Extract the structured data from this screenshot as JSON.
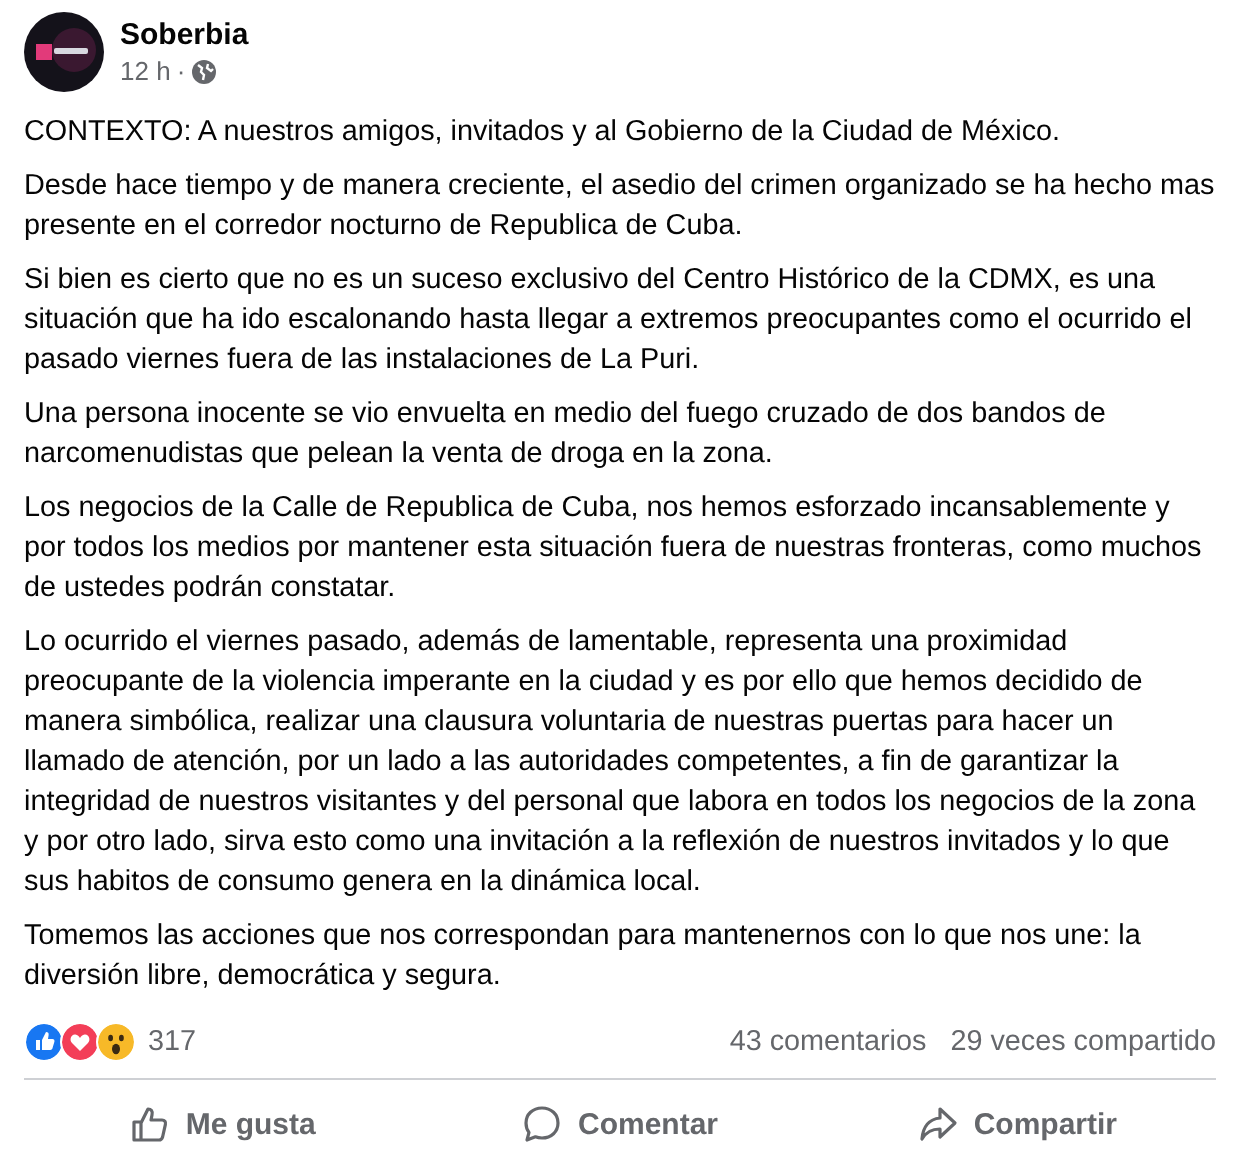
{
  "post": {
    "author": "Soberbia",
    "time": "12 h",
    "separator": "·",
    "paragraphs": [
      "CONTEXTO: A nuestros amigos, invitados y al Gobierno de la Ciudad de México.",
      "Desde hace tiempo y de manera creciente, el asedio del crimen organizado se ha hecho mas presente en el corredor nocturno de Republica de Cuba.",
      "Si bien es cierto que no es un suceso exclusivo del Centro Histórico de la CDMX, es una situación que ha ido escalonando hasta llegar a extremos preocupantes como el ocurrido el pasado viernes fuera de las instalaciones de La Puri.",
      "Una persona inocente se vio envuelta en medio del fuego cruzado de dos bandos de narcomenudistas que pelean la venta de droga en la zona.",
      "Los negocios de la Calle de Republica de Cuba, nos hemos esforzado incansablemente y por todos los medios por mantener esta situación fuera de nuestras fronteras, como muchos de ustedes podrán constatar.",
      "Lo ocurrido el viernes pasado, además de lamentable, representa una proximidad preocupante de la violencia imperante en la ciudad y es por ello que hemos decidido de manera simbólica, realizar una clausura voluntaria de nuestras puertas para hacer un llamado de atención, por un lado a las autoridades competentes, a fin de garantizar la integridad de nuestros visitantes y del personal que labora en todos los negocios de la zona y por otro lado, sirva esto como una invitación a la reflexión de nuestros invitados y lo que sus habitos de consumo genera en la dinámica local.",
      "Tomemos las acciones que nos correspondan para mantenernos con lo que nos une: la diversión libre, democrática y segura."
    ]
  },
  "stats": {
    "reactions": [
      {
        "kind": "like"
      },
      {
        "kind": "love"
      },
      {
        "kind": "wow"
      }
    ],
    "reaction_count": "317",
    "comments": "43 comentarios",
    "shares": "29 veces compartido"
  },
  "actions": [
    {
      "kind": "like",
      "label": "Me gusta"
    },
    {
      "kind": "comment",
      "label": "Comentar"
    },
    {
      "kind": "share",
      "label": "Compartir"
    }
  ]
}
